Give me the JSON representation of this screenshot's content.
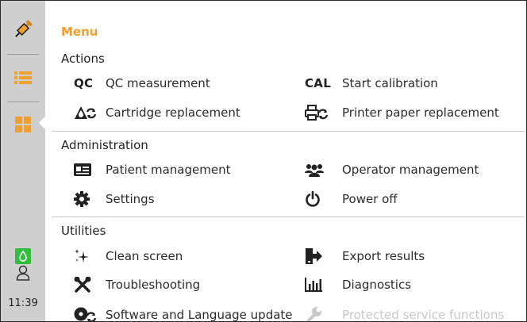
{
  "sidebar": {
    "clock": "11:39"
  },
  "menu": {
    "title": "Menu",
    "sections": {
      "actions": "Actions",
      "administration": "Administration",
      "utilities": "Utilities"
    },
    "items": {
      "qc_abbr": "QC",
      "qc": "QC measurement",
      "cal_abbr": "CAL",
      "cal": "Start calibration",
      "cartridge": "Cartridge replacement",
      "printer_paper": "Printer paper replacement",
      "patient": "Patient management",
      "operator": "Operator management",
      "settings": "Settings",
      "power": "Power off",
      "clean": "Clean screen",
      "export": "Export results",
      "trouble": "Troubleshooting",
      "diagnostics": "Diagnostics",
      "software": "Software and Language update",
      "protected": "Protected service functions"
    }
  },
  "colors": {
    "accent": "#f0a030",
    "active_green": "#2fbf3a",
    "icon_dark": "#222222",
    "disabled": "#c8c8c8"
  }
}
